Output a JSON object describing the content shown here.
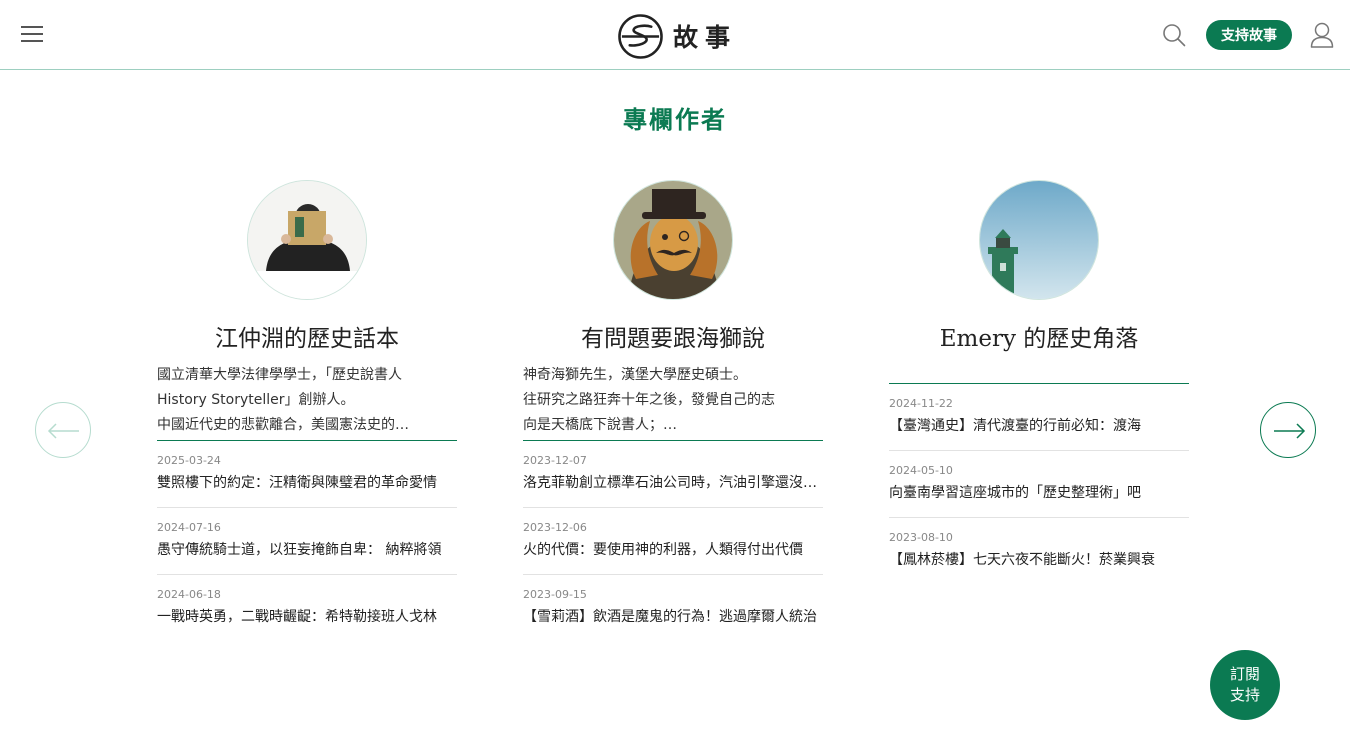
{
  "header": {
    "menu_icon": "hamburger-menu-icon",
    "logo_text": "故事",
    "search_icon": "search-icon",
    "support_label": "支持故事",
    "user_icon": "user-icon"
  },
  "section": {
    "title": "專欄作者"
  },
  "columns": [
    {
      "title": "江仲淵的歷史話本",
      "bio": [
        "國立清華大學法律學學士，「歷史說書人",
        "History Storyteller」創辦人。",
        "中國近代史的悲歡離合，美國憲法史的…"
      ],
      "articles": [
        {
          "date": "2025-03-24",
          "headline": "雙照樓下的約定：汪精衛與陳璧君的革命愛情"
        },
        {
          "date": "2024-07-16",
          "headline": "愚守傳統騎士道，以狂妄掩飾自卑： 納粹將領"
        },
        {
          "date": "2024-06-18",
          "headline": "一戰時英勇，二戰時齷齪：希特勒接班人戈林"
        }
      ]
    },
    {
      "title": "有問題要跟海獅說",
      "bio": [
        "神奇海獅先生，漢堡大學歷史碩士。",
        "往研究之路狂奔十年之後，發覺自己的志",
        "向是天橋底下說書人；…"
      ],
      "articles": [
        {
          "date": "2023-12-07",
          "headline": "洛克菲勒創立標準石油公司時，汽油引擎還沒出現"
        },
        {
          "date": "2023-12-06",
          "headline": "火的代價：要使用神的利器，人類得付出代價"
        },
        {
          "date": "2023-09-15",
          "headline": "【雪莉酒】飲酒是魔鬼的行為！逃過摩爾人統治"
        }
      ]
    },
    {
      "title": "Emery 的歷史角落",
      "bio": [],
      "articles": [
        {
          "date": "2024-11-22",
          "headline": "【臺灣通史】清代渡臺的行前必知：渡海"
        },
        {
          "date": "2024-05-10",
          "headline": "向臺南學習這座城市的「歷史整理術」吧"
        },
        {
          "date": "2023-08-10",
          "headline": "【鳳林菸樓】七天六夜不能斷火！菸業興衰"
        }
      ]
    }
  ],
  "nav": {
    "prev_icon": "arrow-left-icon",
    "next_icon": "arrow-right-icon"
  },
  "subscribe": {
    "line1": "訂閱",
    "line2": "支持"
  },
  "colors": {
    "brand_green": "#0b7a52",
    "divider": "#9dcfc0"
  }
}
